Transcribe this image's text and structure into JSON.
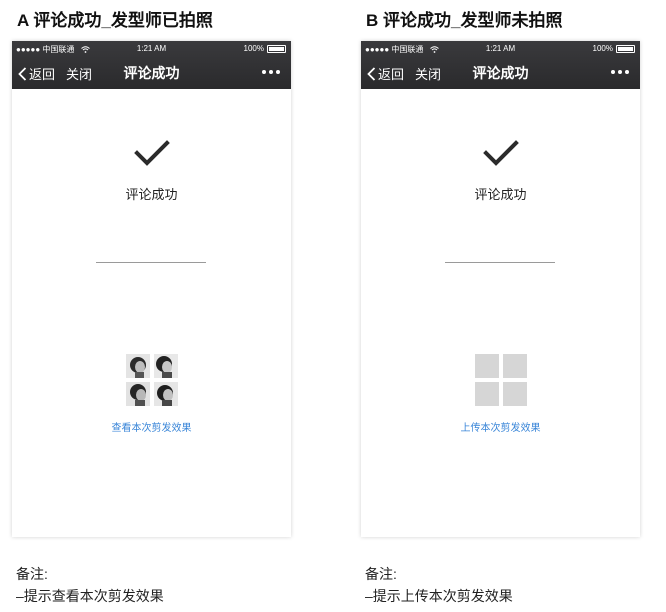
{
  "variants": [
    {
      "heading": "A 评论成功_发型师已拍照",
      "status": {
        "carrier": "●●●●● 中国联通",
        "time": "1:21 AM",
        "battery": "100%"
      },
      "nav": {
        "back": "返回",
        "close": "关闭",
        "title": "评论成功"
      },
      "success_text": "评论成功",
      "link": "查看本次剪发效果",
      "notes_title": "备注:",
      "notes_line": "–提示查看本次剪发效果"
    },
    {
      "heading": "B 评论成功_发型师未拍照",
      "status": {
        "carrier": "●●●●● 中国联通",
        "time": "1:21 AM",
        "battery": "100%"
      },
      "nav": {
        "back": "返回",
        "close": "关闭",
        "title": "评论成功"
      },
      "success_text": "评论成功",
      "link": "上传本次剪发效果",
      "notes_title": "备注:",
      "notes_line": "–提示上传本次剪发效果"
    }
  ],
  "icons": {
    "back": "chevron-left-icon",
    "more": "more-dots-icon",
    "success": "checkmark-icon",
    "wifi": "wifi-icon",
    "battery": "battery-icon"
  },
  "colors": {
    "nav_bg": "#2e2e30",
    "link": "#3a86d8",
    "placeholder": "#d6d6d6",
    "check": "#2b2b2b"
  }
}
